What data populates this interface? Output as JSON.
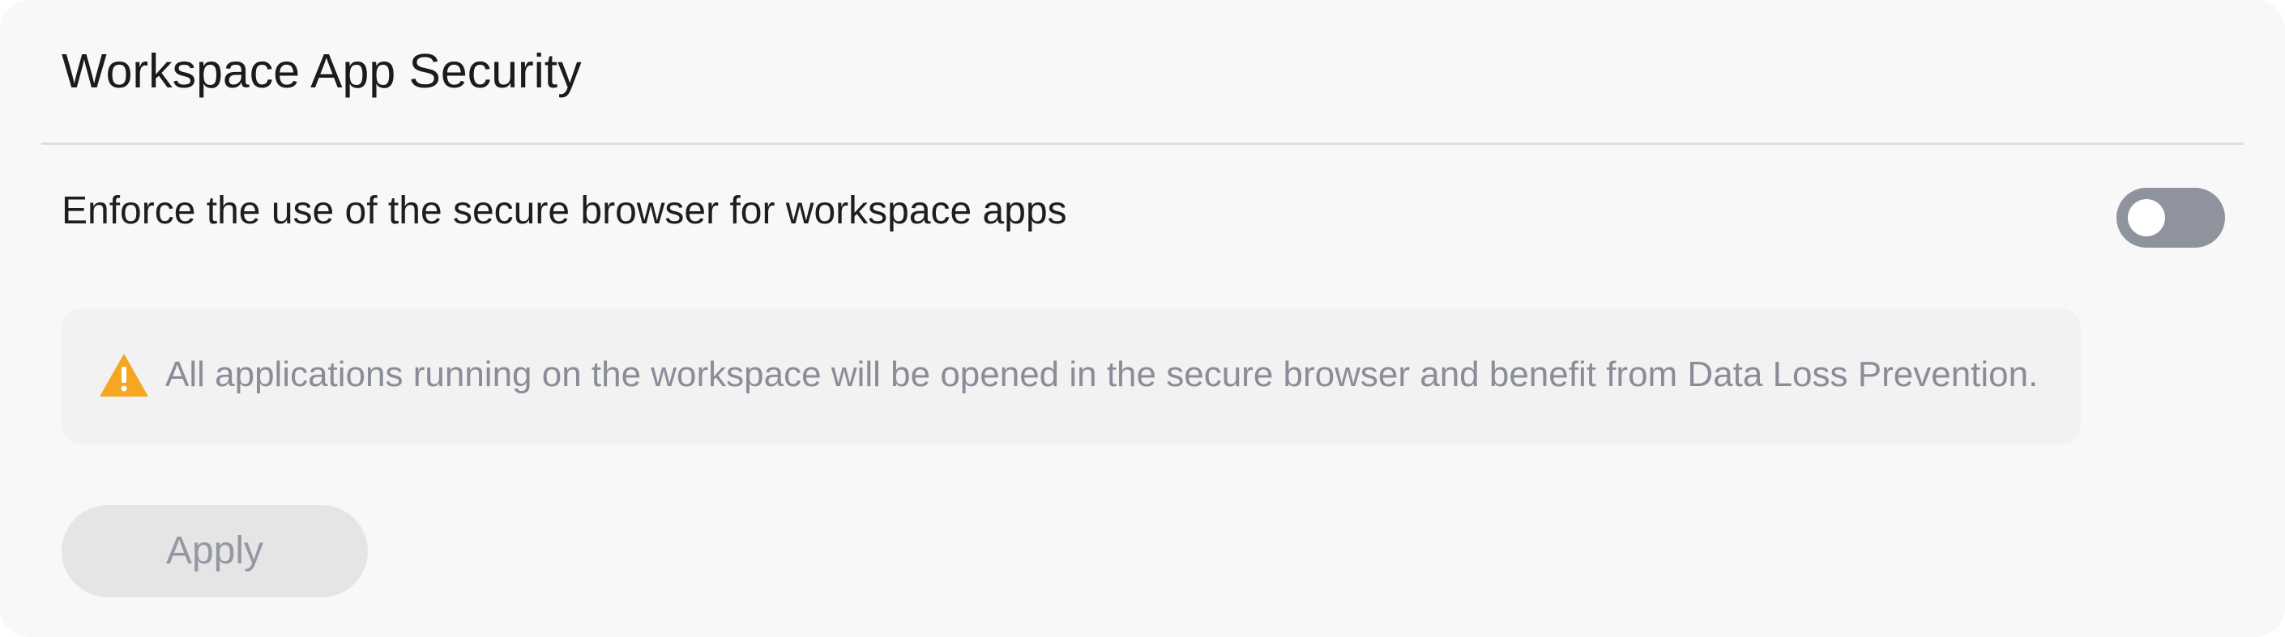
{
  "section": {
    "title": "Workspace App Security"
  },
  "setting": {
    "label": "Enforce the use of the secure browser for workspace apps",
    "toggle_enabled": false
  },
  "info": {
    "icon": "warning-icon",
    "text": "All applications running on the workspace will be opened in the secure browser and benefit from Data Loss Prevention."
  },
  "actions": {
    "apply_label": "Apply",
    "apply_disabled": true
  },
  "colors": {
    "warning": "#f5a623",
    "toggle_off": "#8e939e",
    "text_primary": "#1e1e22",
    "text_muted": "#8a8d98"
  }
}
